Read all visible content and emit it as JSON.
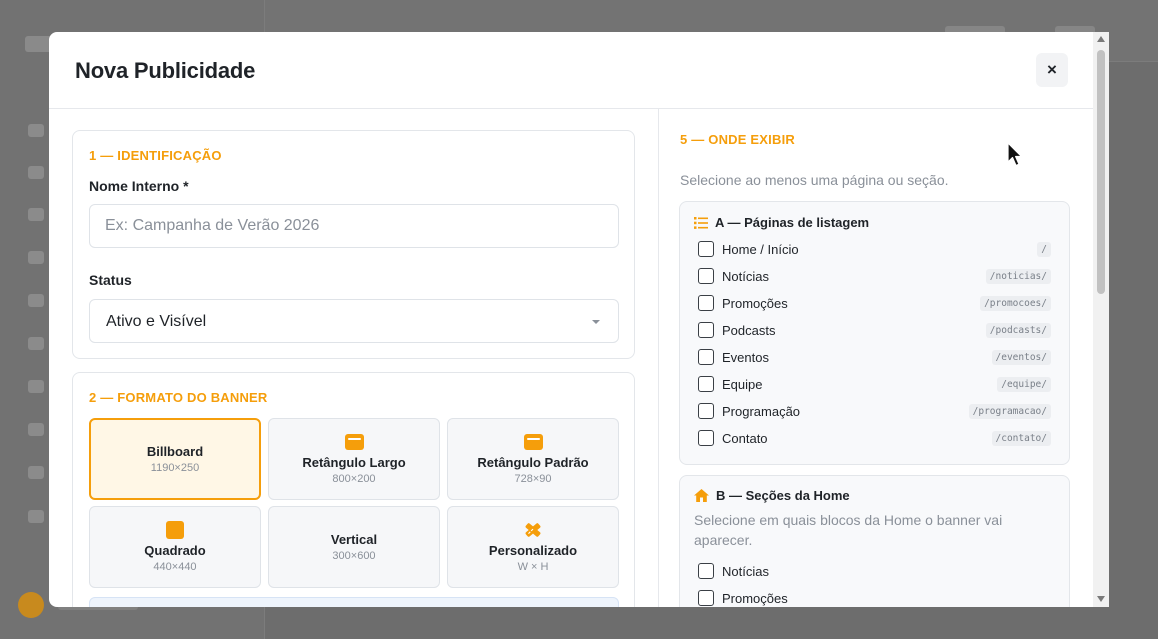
{
  "modal": {
    "title": "Nova Publicidade",
    "close_label": "×"
  },
  "identificacao": {
    "section_title": "1 — IDENTIFICAÇÃO",
    "name_label": "Nome Interno *",
    "name_placeholder": "Ex: Campanha de Verão 2026",
    "name_value": "",
    "status_label": "Status",
    "status_value": "Ativo e Visível"
  },
  "formato": {
    "section_title": "2 — FORMATO DO BANNER",
    "options": [
      {
        "name": "Billboard",
        "size": "1190×250",
        "icon": "none",
        "selected": true
      },
      {
        "name": "Retângulo Largo",
        "size": "800×200",
        "icon": "banner-rect-icon",
        "selected": false
      },
      {
        "name": "Retângulo Padrão",
        "size": "728×90",
        "icon": "banner-rect-icon",
        "selected": false
      },
      {
        "name": "Quadrado",
        "size": "440×440",
        "icon": "square-icon",
        "selected": false
      },
      {
        "name": "Vertical",
        "size": "300×600",
        "icon": "none",
        "selected": false
      },
      {
        "name": "Personalizado",
        "size": "W × H",
        "icon": "pencil-ruler-icon",
        "selected": false
      }
    ]
  },
  "onde_exibir": {
    "section_title": "5 — ONDE EXIBIR",
    "hint": "Selecione ao menos uma página ou seção.",
    "listagem": {
      "title": "A — Páginas de listagem",
      "icon": "list-icon",
      "items": [
        {
          "label": "Home / Início",
          "slug": "/"
        },
        {
          "label": "Notícias",
          "slug": "/noticias/"
        },
        {
          "label": "Promoções",
          "slug": "/promocoes/"
        },
        {
          "label": "Podcasts",
          "slug": "/podcasts/"
        },
        {
          "label": "Eventos",
          "slug": "/eventos/"
        },
        {
          "label": "Equipe",
          "slug": "/equipe/"
        },
        {
          "label": "Programação",
          "slug": "/programacao/"
        },
        {
          "label": "Contato",
          "slug": "/contato/"
        }
      ]
    },
    "secoes_home": {
      "title": "B — Seções da Home",
      "icon": "home-icon",
      "description": "Selecione em quais blocos da Home o banner vai aparecer.",
      "items": [
        {
          "label": "Notícias"
        },
        {
          "label": "Promoções"
        }
      ]
    }
  },
  "colors": {
    "accent": "#f59e0b",
    "selected_bg": "#fff7e6",
    "text": "#1f2328",
    "muted": "#8a9099"
  }
}
